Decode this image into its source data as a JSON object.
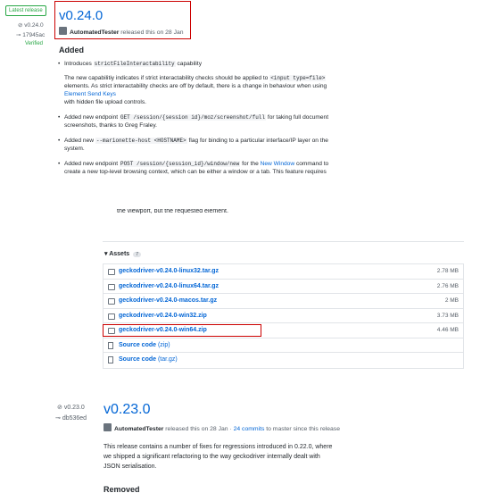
{
  "release1": {
    "badge": "Latest release",
    "tag": "v0.24.0",
    "commit": "17945ac",
    "verified": "Verified",
    "title": "v0.24.0",
    "author": "AutomatedTester",
    "released_text": "released this on 28 Jan",
    "section_heading": "Added",
    "item1_pre": "Introduces",
    "item1_code": "strictFileInteractability",
    "item1_post": "capability",
    "item1_para_a": "The new capabilitiy indicates if strict interactability checks should be applied to",
    "item1_para_code": "<input type=file>",
    "item1_para_b": "elements. As strict interactability checks are off by default, there is a change in behaviour when using",
    "item1_para_link": "Element Send Keys",
    "item1_para_c": "with hidden file upload controls.",
    "item2_pre": "Added new endpoint",
    "item2_code": "GET /session/{session id}/moz/screenshot/full",
    "item2_post": "for taking full document screenshots, thanks to Greg Fraley.",
    "item3_pre": "Added new",
    "item3_code": "--marionette-host <HOSTNAME>",
    "item3_post": "flag for binding to a particular interface/IP layer on the system.",
    "item4_pre": "Added new endpoint",
    "item4_code": "POST /session/{session_id}/window/new",
    "item4_mid": "for the",
    "item4_link": "New Window",
    "item4_post": "command to create a new top-level browsing context, which can be either a window or a tab. This feature requires",
    "cut_text": "the viewport, but the requested element."
  },
  "assets": {
    "label": "Assets",
    "count": "7",
    "files": [
      {
        "name": "geckodriver-v0.24.0-linux32.tar.gz",
        "size": "2.78 MB"
      },
      {
        "name": "geckodriver-v0.24.0-linux64.tar.gz",
        "size": "2.76 MB"
      },
      {
        "name": "geckodriver-v0.24.0-macos.tar.gz",
        "size": "2 MB"
      },
      {
        "name": "geckodriver-v0.24.0-win32.zip",
        "size": "3.73 MB"
      },
      {
        "name": "geckodriver-v0.24.0-win64.zip",
        "size": "4.46 MB"
      }
    ],
    "source_zip_label": "Source code",
    "source_zip_ext": "(zip)",
    "source_tar_label": "Source code",
    "source_tar_ext": "(tar.gz)"
  },
  "release2": {
    "tag": "v0.23.0",
    "commit": "db536ed",
    "title": "v0.23.0",
    "author": "AutomatedTester",
    "released_text": "released this on 28 Jan ·",
    "commits_link": "24 commits",
    "commits_suffix": "to master since this release",
    "description": "This release contains a number of fixes for regressions introduced in 0.22.0, where we shipped a significant refactoring to the way geckodriver internally dealt with JSON serialisation.",
    "section_heading": "Removed"
  },
  "colors": {
    "link": "#0366d6",
    "highlight": "#cc0000",
    "verified": "#28a745"
  }
}
